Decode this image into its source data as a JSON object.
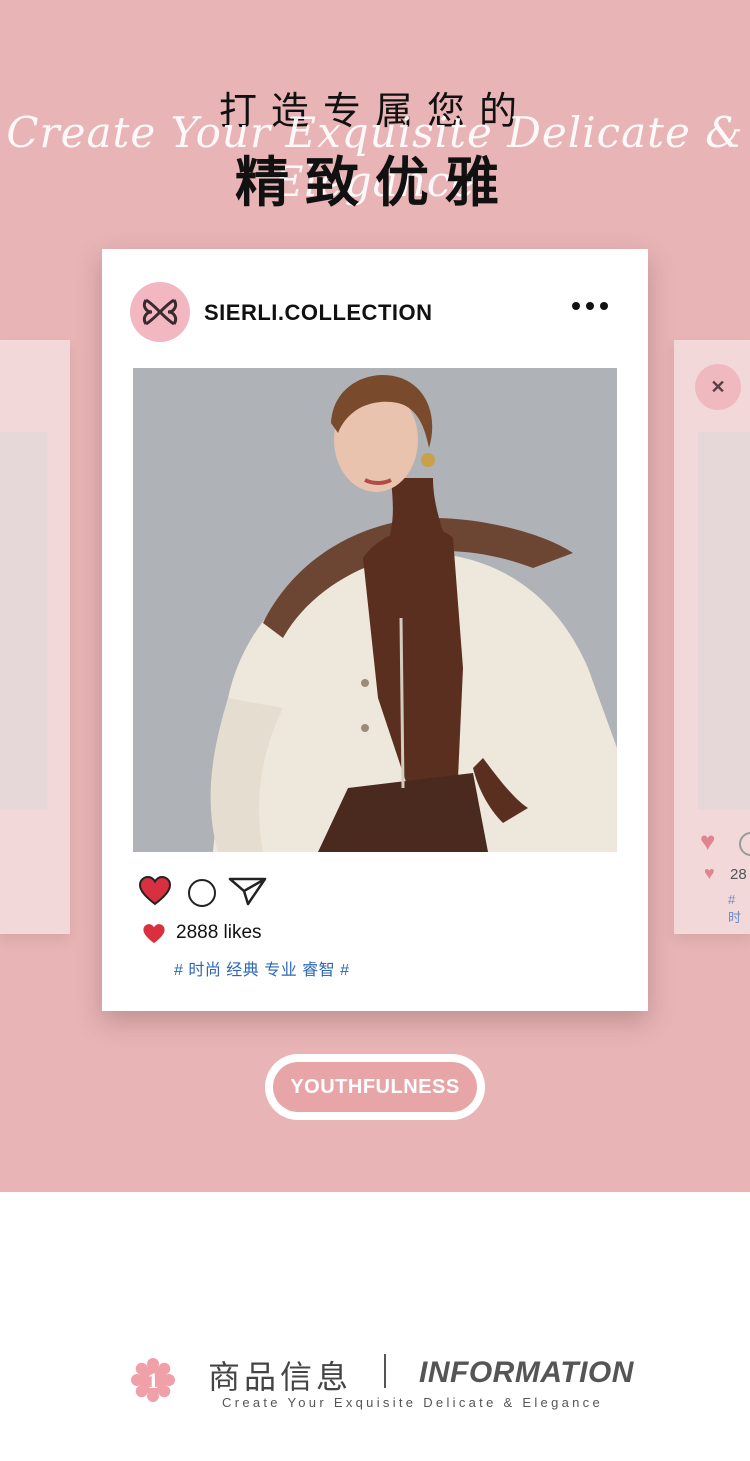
{
  "hero": {
    "title_line1": "打造专属您的",
    "script_line": "Create Your Exquisite Delicate & Elegance",
    "title_line2": "精致优雅"
  },
  "post": {
    "handle": "SIERLI.COLLECTION",
    "likes": "2888 likes",
    "tags": "# 时尚 经典 专业 睿智 #",
    "icons": [
      "logo-icon",
      "more-icon",
      "heart-icon",
      "comment-icon",
      "send-icon"
    ]
  },
  "ghost_right": {
    "likes_fragment": "28",
    "tags_fragment": "# 时"
  },
  "pill": {
    "label": "YOUTHFULNESS"
  },
  "info": {
    "number": "1",
    "cn_title": "商品信息",
    "en_title": "INFORMATION",
    "subtitle": "Create Your Exquisite Delicate & Elegance"
  },
  "colors": {
    "hero_bg": "#e8b4b5",
    "pill": "#e8a5a8",
    "heart": "#d9303f",
    "tag_blue": "#2e67b5",
    "badge": "#f0a0a8"
  }
}
